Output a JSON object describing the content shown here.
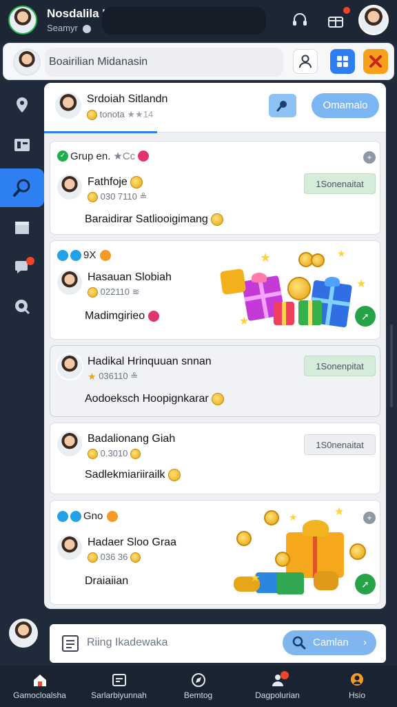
{
  "topbar": {
    "title": "Nosdalila Ihadaagl",
    "subtitle": "Seamyr",
    "subtitle_icon": "clock-icon"
  },
  "search": {
    "placeholder": "Boairilian Midanasin"
  },
  "panel": {
    "header_name": "Srdoiah Sitlandn",
    "header_meta": "tonota",
    "header_stars": "★★14",
    "header_button": "Omamalo"
  },
  "cards": [
    {
      "group": "Grup en.",
      "group_suffix": "★Cc",
      "name": "Fathfoje",
      "meta": "030 7110",
      "meta_suffix": "≗",
      "desc": "Baraidirar Satliooigimang",
      "tag": "1Sonenaitat"
    },
    {
      "group": "9X",
      "name": "Hasauan Slobiah",
      "meta": "022110",
      "meta_suffix": "≋",
      "desc": "Madimgirieo"
    },
    {
      "name": "Hadikal Hrinquuan snnan",
      "meta": "036110",
      "meta_suffix": "≗",
      "desc": "Aodoeksch Hoopignkarar",
      "tag": "1Sonenpitat"
    },
    {
      "name": "Badalionang Giah",
      "meta": "0.3010",
      "desc": "Sadlekmiariirailk",
      "tag": "1S0nenaitat"
    },
    {
      "group": "Gno",
      "name": "Hadaer Sloo Graa",
      "meta": "036 36",
      "desc": "Draiaiian"
    }
  ],
  "compose": {
    "placeholder": "Riing Ikadewaka",
    "send_label": "Camlan"
  },
  "nav": [
    {
      "label": "Gamocloalsha",
      "icon": "home-icon"
    },
    {
      "label": "Sarlarbiyunnah",
      "icon": "inbox-icon"
    },
    {
      "label": "Bemtog",
      "icon": "compass-icon"
    },
    {
      "label": "Dagpolurian",
      "icon": "people-icon"
    },
    {
      "label": "Hsio",
      "icon": "person-icon"
    }
  ],
  "colors": {
    "accent": "#2d7ff0",
    "background": "#1f2a3a",
    "badge": "#f0452b",
    "success": "#25a346"
  }
}
